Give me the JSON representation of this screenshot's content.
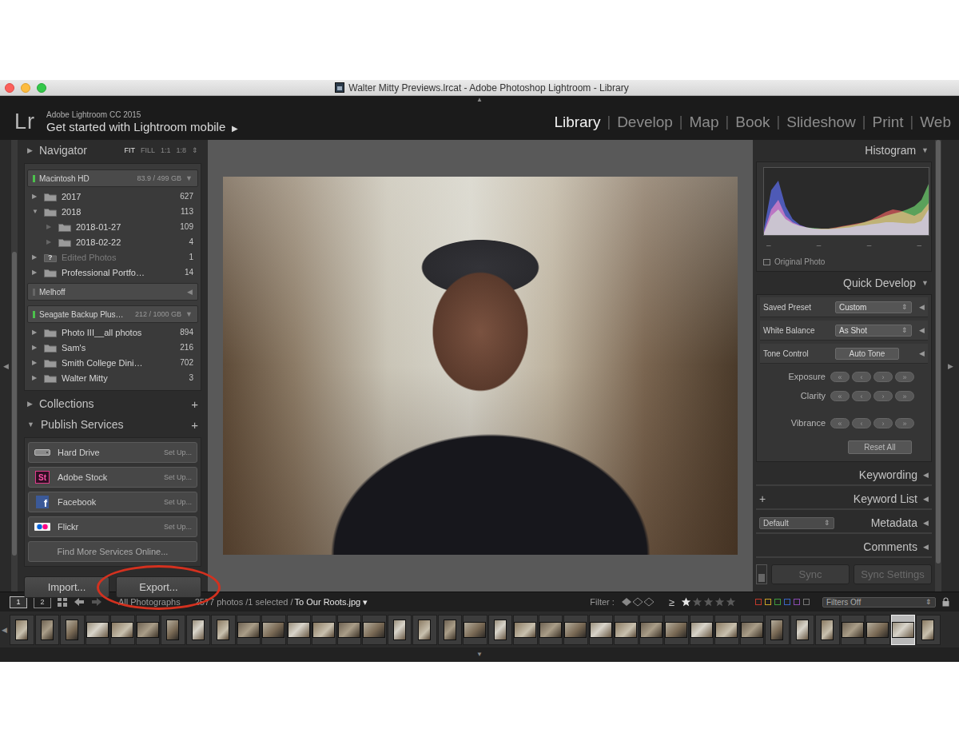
{
  "window": {
    "title": "Walter Mitty Previews.lrcat - Adobe Photoshop Lightroom - Library"
  },
  "header": {
    "logo": "Lr",
    "product": "Adobe Lightroom CC 2015",
    "mobile_link": "Get started with Lightroom mobile",
    "mobile_arrow": "▶",
    "collapse_arrow": "▲",
    "module_separator": "|",
    "modules": [
      {
        "label": "Library",
        "selected": true
      },
      {
        "label": "Develop",
        "selected": false
      },
      {
        "label": "Map",
        "selected": false
      },
      {
        "label": "Book",
        "selected": false
      },
      {
        "label": "Slideshow",
        "selected": false
      },
      {
        "label": "Print",
        "selected": false
      },
      {
        "label": "Web",
        "selected": false
      }
    ]
  },
  "left_panel": {
    "collapse_arrow": "◀",
    "navigator": {
      "title": "Navigator",
      "toggle": "▶",
      "expanded": false,
      "zoom": [
        {
          "label": "FIT",
          "selected": true
        },
        {
          "label": "FILL",
          "selected": false
        },
        {
          "label": "1:1",
          "selected": false
        },
        {
          "label": "1:8",
          "selected": false
        }
      ],
      "zoom_menu": "⇕"
    },
    "volumes": [
      {
        "name": "Macintosh HD",
        "usage": "83.9 / 499 GB",
        "online": true,
        "expanded": true,
        "toggle": "▼",
        "folders": [
          {
            "name": "2017",
            "count": "627",
            "level": 0,
            "toggle": "▶",
            "expanded": false,
            "missing": false
          },
          {
            "name": "2018",
            "count": "113",
            "level": 0,
            "toggle": "▼",
            "expanded": true,
            "missing": false
          },
          {
            "name": "2018-01-27",
            "count": "109",
            "level": 1,
            "toggle": "▶",
            "expanded": false,
            "missing": false
          },
          {
            "name": "2018-02-22",
            "count": "4",
            "level": 1,
            "toggle": "▶",
            "expanded": false,
            "missing": false
          },
          {
            "name": "Edited Photos",
            "count": "1",
            "level": 0,
            "toggle": "▶",
            "expanded": false,
            "missing": true,
            "mark": "?"
          },
          {
            "name": "Professional Portfo…",
            "count": "14",
            "level": 0,
            "toggle": "▶",
            "expanded": false,
            "missing": false
          }
        ]
      },
      {
        "name": "Melhoff",
        "usage": "",
        "online": false,
        "expanded": false,
        "toggle": "◀",
        "folders": []
      },
      {
        "name": "Seagate Backup Plus…",
        "usage": "212 / 1000 GB",
        "online": true,
        "expanded": true,
        "toggle": "▼",
        "folders": [
          {
            "name": "Photo III__all photos",
            "count": "894",
            "level": 0,
            "toggle": "▶",
            "expanded": false,
            "missing": false
          },
          {
            "name": "Sam's",
            "count": "216",
            "level": 0,
            "toggle": "▶",
            "expanded": false,
            "missing": false
          },
          {
            "name": "Smith College Dini…",
            "count": "702",
            "level": 0,
            "toggle": "▶",
            "expanded": false,
            "missing": false
          },
          {
            "name": "Walter Mitty",
            "count": "3",
            "level": 0,
            "toggle": "▶",
            "expanded": false,
            "missing": false
          }
        ]
      }
    ],
    "collections": {
      "title": "Collections",
      "toggle": "▶",
      "add": "+"
    },
    "publish_services": {
      "title": "Publish Services",
      "toggle": "▼",
      "add": "+",
      "services": [
        {
          "name": "Hard Drive",
          "action": "Set Up...",
          "kind": "drive"
        },
        {
          "name": "Adobe Stock",
          "action": "Set Up...",
          "kind": "stock",
          "icon_text": "St"
        },
        {
          "name": "Facebook",
          "action": "Set Up...",
          "kind": "facebook",
          "icon_text": "f"
        },
        {
          "name": "Flickr",
          "action": "Set Up...",
          "kind": "flickr"
        }
      ],
      "find_more": "Find More Services Online..."
    },
    "buttons": [
      {
        "label": "Import...",
        "annotated": false
      },
      {
        "label": "Export...",
        "annotated": true
      }
    ]
  },
  "right_panel": {
    "collapse_arrow": "▶",
    "histogram": {
      "title": "Histogram",
      "toggle": "▼",
      "series": [
        {
          "name": "red",
          "color": "#d23b3b",
          "values": [
            5,
            40,
            55,
            30,
            20,
            15,
            12,
            10,
            10,
            10,
            12,
            14,
            16,
            18,
            20,
            24,
            30,
            36,
            40,
            38,
            34,
            30,
            36,
            50
          ]
        },
        {
          "name": "green",
          "color": "#4cbf4c",
          "values": [
            3,
            30,
            40,
            25,
            18,
            14,
            12,
            11,
            10,
            10,
            11,
            13,
            15,
            17,
            20,
            23,
            26,
            30,
            33,
            36,
            40,
            45,
            55,
            80
          ]
        },
        {
          "name": "blue",
          "color": "#3a4ee0",
          "values": [
            10,
            70,
            85,
            45,
            25,
            16,
            12,
            10,
            9,
            9,
            10,
            11,
            12,
            14,
            15,
            17,
            18,
            20,
            20,
            19,
            18,
            18,
            22,
            40
          ]
        }
      ],
      "readouts": [
        "–",
        "–",
        "–",
        "–"
      ],
      "original_photo": {
        "label": "Original Photo",
        "checked": false
      }
    },
    "quick_develop": {
      "title": "Quick Develop",
      "toggle": "▼",
      "rows": [
        {
          "kind": "select",
          "label": "Saved Preset",
          "value": "Custom",
          "menu": "⇕",
          "arrow": "◀"
        },
        {
          "kind": "select",
          "label": "White Balance",
          "value": "As Shot",
          "menu": "⇕",
          "arrow": "◀"
        },
        {
          "kind": "button",
          "label": "Tone Control",
          "value": "Auto Tone",
          "arrow": "◀"
        },
        {
          "kind": "stepper",
          "label": "Exposure",
          "steps": [
            "«",
            "‹",
            "›",
            "»"
          ]
        },
        {
          "kind": "stepper",
          "label": "Clarity",
          "steps": [
            "«",
            "‹",
            "›",
            "»"
          ]
        },
        {
          "kind": "stepper",
          "label": "Vibrance",
          "steps": [
            "«",
            "‹",
            "›",
            "»"
          ]
        },
        {
          "kind": "reset",
          "label": "Reset All"
        }
      ]
    },
    "panels": [
      {
        "title": "Keywording",
        "toggle": "◀"
      },
      {
        "title": "Keyword List",
        "toggle": "◀",
        "add": "+"
      },
      {
        "title": "Metadata",
        "toggle": "◀",
        "preset": "Default",
        "menu": "⇕"
      },
      {
        "title": "Comments",
        "toggle": "◀"
      }
    ],
    "sync": {
      "switch_on": false,
      "buttons": [
        {
          "label": "Sync",
          "disabled": true
        },
        {
          "label": "Sync Settings",
          "disabled": true
        }
      ]
    }
  },
  "toolbar": {
    "screens": [
      {
        "label": "1",
        "selected": true
      },
      {
        "label": "2",
        "selected": false
      }
    ],
    "source": "All Photographs",
    "info": "2577 photos /1 selected /",
    "filename": "To Our Roots.jpg",
    "file_menu": "▾",
    "filter_label": "Filter :",
    "rating_op": "≥",
    "stars": 1,
    "color_labels": [
      {
        "color": "#c0392b",
        "selected": false
      },
      {
        "color": "#c9a227",
        "selected": false
      },
      {
        "color": "#3e9a3e",
        "selected": false
      },
      {
        "color": "#3a66c4",
        "selected": false
      },
      {
        "color": "#8a4bb0",
        "selected": false
      },
      {
        "color": "#777777",
        "selected": false
      }
    ],
    "filters": "Filters Off",
    "filters_menu": "⇕"
  },
  "filmstrip": {
    "toggle": "◀",
    "bottom_arrow": "▼",
    "thumbnails": [
      {
        "kind": "portrait",
        "selected": false
      },
      {
        "kind": "portrait",
        "selected": false
      },
      {
        "kind": "portrait",
        "selected": false
      },
      {
        "kind": "landscape",
        "selected": false
      },
      {
        "kind": "landscape",
        "selected": false
      },
      {
        "kind": "landscape",
        "selected": false
      },
      {
        "kind": "portrait",
        "selected": false
      },
      {
        "kind": "portrait",
        "selected": false
      },
      {
        "kind": "portrait",
        "selected": false
      },
      {
        "kind": "landscape",
        "selected": false
      },
      {
        "kind": "landscape",
        "selected": false
      },
      {
        "kind": "landscape",
        "selected": false
      },
      {
        "kind": "landscape",
        "selected": false
      },
      {
        "kind": "landscape",
        "selected": false
      },
      {
        "kind": "landscape",
        "selected": false
      },
      {
        "kind": "portrait",
        "selected": false
      },
      {
        "kind": "portrait",
        "selected": false
      },
      {
        "kind": "portrait",
        "selected": false
      },
      {
        "kind": "landscape",
        "selected": false
      },
      {
        "kind": "portrait",
        "selected": false
      },
      {
        "kind": "landscape",
        "selected": false
      },
      {
        "kind": "landscape",
        "selected": false
      },
      {
        "kind": "landscape",
        "selected": false
      },
      {
        "kind": "landscape",
        "selected": false
      },
      {
        "kind": "landscape",
        "selected": false
      },
      {
        "kind": "landscape",
        "selected": false
      },
      {
        "kind": "landscape",
        "selected": false
      },
      {
        "kind": "landscape",
        "selected": false
      },
      {
        "kind": "landscape",
        "selected": false
      },
      {
        "kind": "landscape",
        "selected": false
      },
      {
        "kind": "portrait",
        "selected": false
      },
      {
        "kind": "portrait",
        "selected": false
      },
      {
        "kind": "portrait",
        "selected": false
      },
      {
        "kind": "landscape",
        "selected": false
      },
      {
        "kind": "landscape",
        "selected": false
      },
      {
        "kind": "landscape",
        "selected": true
      },
      {
        "kind": "portrait",
        "selected": false
      }
    ]
  }
}
